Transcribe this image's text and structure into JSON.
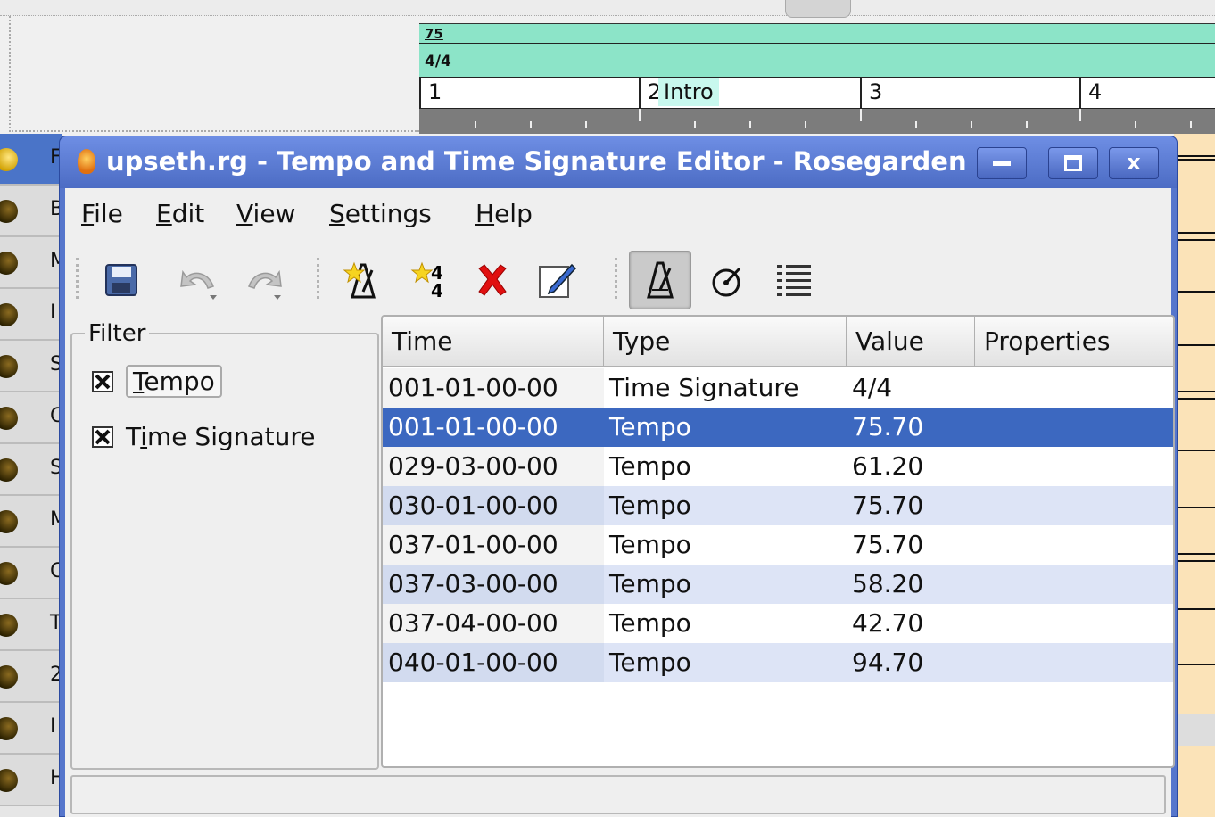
{
  "background": {
    "tempo_ruler_value": "75",
    "time_signature_value": "4/4",
    "bar_numbers": [
      "1",
      "2",
      "3",
      "4"
    ],
    "marker_label": "Intro",
    "track_initials": [
      "F",
      "B",
      "M",
      "I",
      "S",
      "C",
      "S",
      "M",
      "C",
      "T",
      "2",
      "I",
      "H"
    ]
  },
  "window": {
    "title": "upseth.rg - Tempo and Time Signature Editor - Rosegarden",
    "minimize_icon": "minimize-icon",
    "maximize_icon": "maximize-icon",
    "close_icon": "close-icon",
    "close_label": "x"
  },
  "menu": {
    "file": {
      "mnemonic": "F",
      "rest": "ile"
    },
    "edit": {
      "mnemonic": "E",
      "rest": "dit"
    },
    "view": {
      "mnemonic": "V",
      "rest": "iew"
    },
    "settings": {
      "mnemonic": "S",
      "rest": "ettings"
    },
    "help": {
      "mnemonic": "H",
      "rest": "elp"
    }
  },
  "toolbar": {
    "icons": [
      "save-icon",
      "undo-icon",
      "redo-icon",
      "insert-tempo-icon",
      "insert-time-signature-icon",
      "delete-icon",
      "edit-icon",
      "tempo-filter-icon",
      "time-signature-filter-icon",
      "list-icon"
    ]
  },
  "filter": {
    "legend": "Filter",
    "tempo": {
      "prefix": "",
      "mnemonic": "T",
      "rest": "empo",
      "checked": true
    },
    "time_signature": {
      "prefix": "T",
      "mnemonic": "i",
      "rest": "me Signature",
      "checked": true
    }
  },
  "table": {
    "columns": [
      "Time",
      "Type",
      "Value",
      "Properties"
    ],
    "rows": [
      {
        "time": "001-01-00-00",
        "type": "Time Signature",
        "value": "4/4",
        "properties": ""
      },
      {
        "time": "001-01-00-00",
        "type": "Tempo",
        "value": "75.70",
        "properties": ""
      },
      {
        "time": "029-03-00-00",
        "type": "Tempo",
        "value": "61.20",
        "properties": ""
      },
      {
        "time": "030-01-00-00",
        "type": "Tempo",
        "value": "75.70",
        "properties": ""
      },
      {
        "time": "037-01-00-00",
        "type": "Tempo",
        "value": "75.70",
        "properties": ""
      },
      {
        "time": "037-03-00-00",
        "type": "Tempo",
        "value": "58.20",
        "properties": ""
      },
      {
        "time": "037-04-00-00",
        "type": "Tempo",
        "value": "42.70",
        "properties": ""
      },
      {
        "time": "040-01-00-00",
        "type": "Tempo",
        "value": "94.70",
        "properties": ""
      }
    ],
    "selected_row": 1
  },
  "colors": {
    "title_bar": "#5676cc",
    "selection": "#3c68c0",
    "tempo_ruler": "#8ce4c8",
    "segment_area": "#fbe3b8"
  }
}
